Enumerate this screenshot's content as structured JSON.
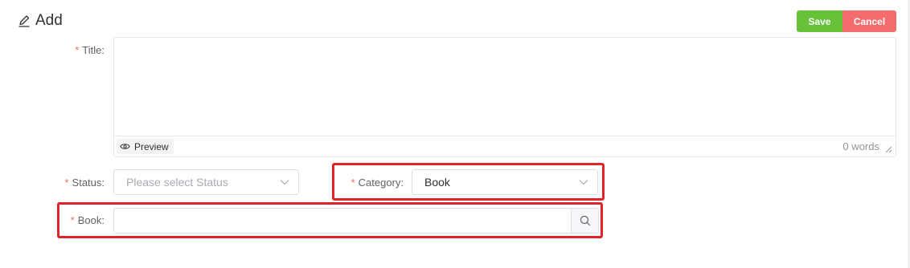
{
  "header": {
    "title": "Add",
    "icon": "edit-icon"
  },
  "actions": {
    "save_label": "Save",
    "cancel_label": "Cancel"
  },
  "colors": {
    "save": "#67c23a",
    "cancel": "#f56c6c",
    "required": "#f56c6c",
    "highlight": "#e0242a"
  },
  "form": {
    "required_mark": "*",
    "title": {
      "label": "Title:",
      "value": "",
      "preview_label": "Preview",
      "word_count": "0 words"
    },
    "status": {
      "label": "Status:",
      "placeholder": "Please select Status",
      "value": ""
    },
    "category": {
      "label": "Category:",
      "value": "Book"
    },
    "book": {
      "label": "Book:",
      "value": ""
    }
  }
}
